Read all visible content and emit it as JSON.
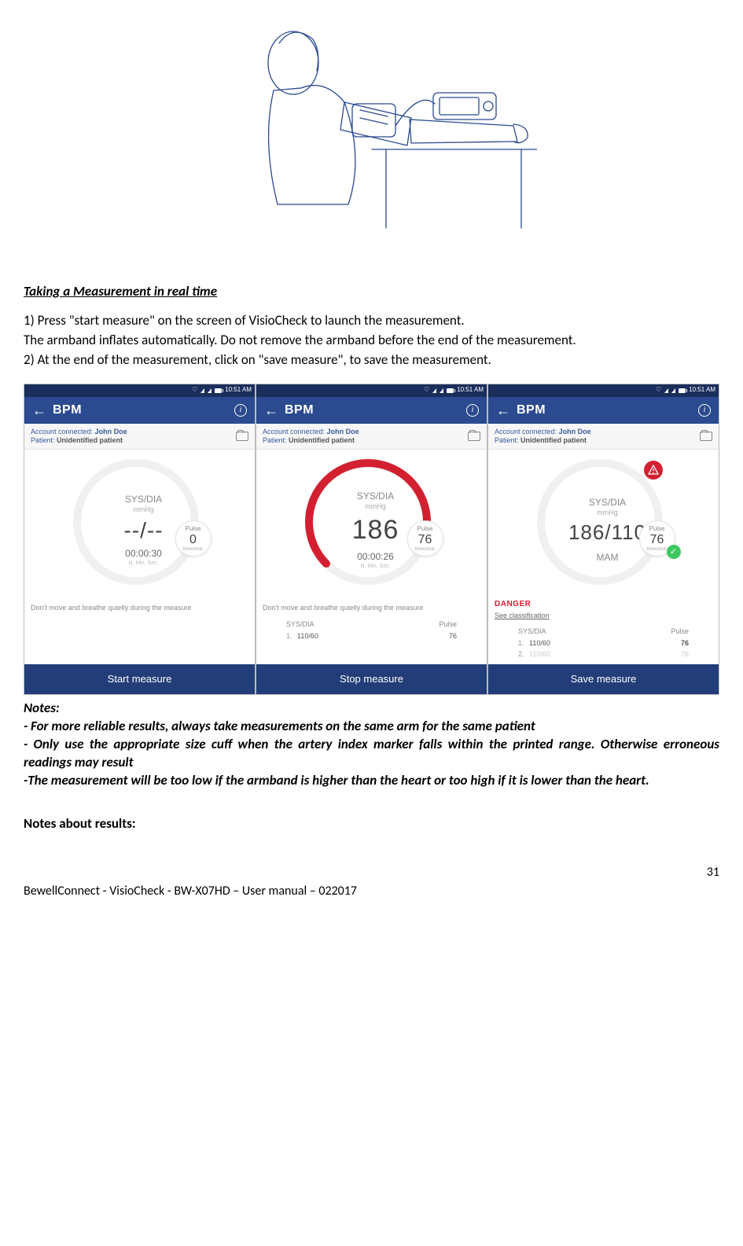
{
  "figure_alt": "Line drawing of a seated person with an arm cuff and a handheld device on a table",
  "heading": "Taking a Measurement in real time",
  "instructions": {
    "step1": "1) Press \"start measure\" on the screen of VisioCheck to launch the measurement.",
    "step1b": "The armband inflates automatically. Do not remove the armband before the end of the measurement.",
    "step2": "2) At the end of the measurement, click on \"save measure\", to save the measurement."
  },
  "status_time": "10:51 AM",
  "app": {
    "title": "BPM",
    "account_label": "Account connected:",
    "account_name": "John Doe",
    "patient_label": "Patient:",
    "patient_name": "Unidentified patient",
    "sysdia": "SYS/DIA",
    "mmhg": "mmHg",
    "pulse_label": "Pulse",
    "pulse_unit": "times/min",
    "timer_label": "H.  Min. Sec.",
    "hint": "Don't move and breathe quietly during the measure",
    "history_sysdia": "SYS/DIA",
    "history_pulse": "Pulse"
  },
  "screens": [
    {
      "reading": "--/--",
      "timer": "00:00:30",
      "pulse": "0",
      "button": "Start measure"
    },
    {
      "reading": "186",
      "timer": "00:00:26",
      "pulse": "76",
      "hist_val": "110/60",
      "hist_pulse": "76",
      "button": "Stop measure"
    },
    {
      "reading": "186/110",
      "mam": "MAM",
      "pulse": "76",
      "danger": "DANGER",
      "classification": "See classification",
      "hist1_val": "110/60",
      "hist1_pulse": "76",
      "hist2_val": "110/60",
      "hist2_pulse": "76",
      "button": "Save measure"
    }
  ],
  "notes_heading": "Notes:",
  "notes": [
    "- For more reliable results, always take measurements on the same arm for the same patient",
    "- Only use the appropriate size cuff when the artery index marker falls within the printed range. Otherwise erroneous readings may result",
    "-The measurement will be too low if the armband is higher than the heart or too high if it is lower than the heart."
  ],
  "notes_about": "Notes about results:",
  "page_number": "31",
  "footer": "BewellConnect - VisioCheck - BW-X07HD – User manual – 022017"
}
